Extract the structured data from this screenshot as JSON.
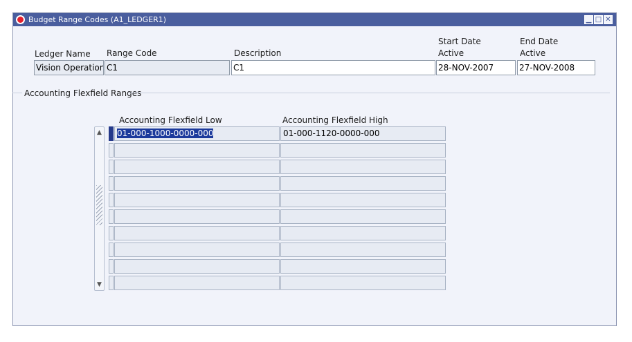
{
  "window": {
    "title": "Budget Range Codes (A1_LEDGER1)",
    "controls": {
      "minimize": "▁",
      "maximize": "□",
      "close": "✕"
    }
  },
  "header": {
    "ledger_name_label": "Ledger Name",
    "range_code_label": "Range Code",
    "description_label": "Description",
    "start_date_label_1": "Start Date",
    "start_date_label_2": "Active",
    "end_date_label_1": "End Date",
    "end_date_label_2": "Active",
    "ledger_name_value": "Vision Operation",
    "range_code_value": "C1",
    "description_value": "C1",
    "start_date_value": "28-NOV-2007",
    "end_date_value": "27-NOV-2008"
  },
  "ranges": {
    "section_title": "Accounting Flexfield Ranges",
    "col_low": "Accounting Flexfield Low",
    "col_high": "Accounting Flexfield High",
    "rows": [
      {
        "low": "01-000-1000-0000-000",
        "high": "01-000-1120-0000-000"
      },
      {
        "low": "",
        "high": ""
      },
      {
        "low": "",
        "high": ""
      },
      {
        "low": "",
        "high": ""
      },
      {
        "low": "",
        "high": ""
      },
      {
        "low": "",
        "high": ""
      },
      {
        "low": "",
        "high": ""
      },
      {
        "low": "",
        "high": ""
      },
      {
        "low": "",
        "high": ""
      },
      {
        "low": "",
        "high": ""
      }
    ]
  },
  "scrollbar": {
    "up": "▲",
    "down": "▼"
  },
  "colors": {
    "titlebar": "#4a5e9e",
    "window_bg": "#f1f3fa",
    "selection": "#1c3a9c"
  }
}
